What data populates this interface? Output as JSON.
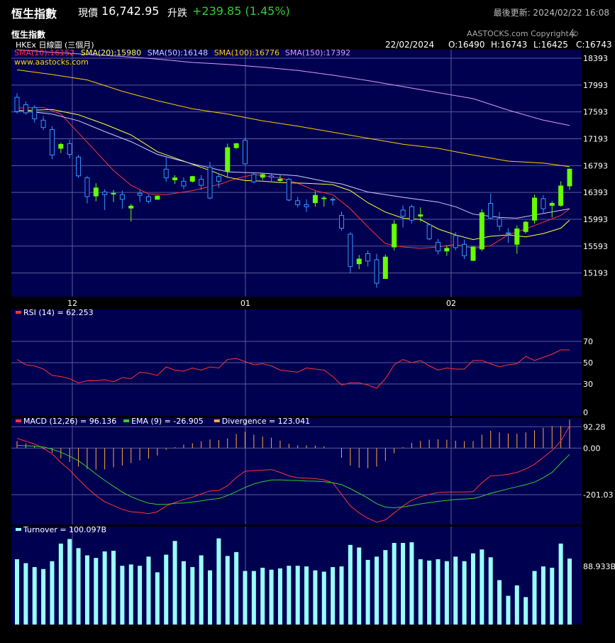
{
  "header": {
    "title": "恆生指數",
    "price_label": "現價",
    "price": "16,742.95",
    "change_label": "升跌",
    "change": "+239.85 (1.45%)",
    "updated": "最後更新: 2024/02/22 16:08"
  },
  "chart_header": {
    "index_name": "恆生指數",
    "source": "HKEx 日線圖 (三個月)",
    "copyright": "AASTOCKS.com Copyright ©",
    "website": "www.aastocks.com",
    "date": "22/02/2024",
    "open": "O:16490",
    "high": "H:16743",
    "low": "L:16425",
    "close": "C:16743"
  },
  "colors": {
    "panel_bg": "#000050",
    "up_candle": "#66ff00",
    "down_candle": "#3399ff",
    "sma10": "#ff3333",
    "sma20": "#ffff33",
    "sma50": "#ccccff",
    "sma100": "#ffcc00",
    "sma150": "#dd99ff",
    "rsi": "#ff3333",
    "macd": "#ff3333",
    "ema": "#33cc33",
    "divergence": "#ffaa33",
    "turnover": "#99ffff"
  },
  "chart_data": [
    {
      "type": "candlestick",
      "title": "恆生指數",
      "legend": [
        {
          "name": "SMA(10)",
          "value": "16152"
        },
        {
          "name": "SMA(20)",
          "value": "15980"
        },
        {
          "name": "SMA(50)",
          "value": "16148"
        },
        {
          "name": "SMA(100)",
          "value": "16776"
        },
        {
          "name": "SMA(150)",
          "value": "17392"
        }
      ],
      "x_ticks": [
        "12",
        "01",
        "02"
      ],
      "y_ticks": [
        18393,
        17993,
        17593,
        17193,
        16793,
        16393,
        15993,
        15593,
        15193
      ],
      "ylim": [
        14840,
        18520
      ],
      "candles": [
        [
          17810,
          17870,
          17570,
          17600
        ],
        [
          17700,
          17750,
          17550,
          17580
        ],
        [
          17660,
          17690,
          17430,
          17490
        ],
        [
          17470,
          17530,
          17320,
          17360
        ],
        [
          17330,
          17380,
          16890,
          16950
        ],
        [
          17050,
          17130,
          16980,
          17110
        ],
        [
          17120,
          17180,
          16900,
          16960
        ],
        [
          16920,
          16950,
          16610,
          16640
        ],
        [
          16610,
          16640,
          16230,
          16330
        ],
        [
          16340,
          16530,
          16260,
          16460
        ],
        [
          16400,
          16440,
          16130,
          16360
        ],
        [
          16380,
          16430,
          16250,
          16380
        ],
        [
          16360,
          16420,
          16150,
          16290
        ],
        [
          16160,
          16220,
          15960,
          16190
        ],
        [
          16380,
          16430,
          16250,
          16350
        ],
        [
          16330,
          16360,
          16230,
          16260
        ],
        [
          16290,
          16340,
          16290,
          16340
        ],
        [
          16740,
          16930,
          16550,
          16610
        ],
        [
          16580,
          16650,
          16520,
          16610
        ],
        [
          16560,
          16620,
          16440,
          16490
        ],
        [
          16560,
          16640,
          16540,
          16630
        ],
        [
          16590,
          16650,
          16430,
          16500
        ],
        [
          16770,
          16850,
          16290,
          16310
        ],
        [
          16630,
          16660,
          16460,
          16560
        ],
        [
          16710,
          17120,
          16620,
          17060
        ],
        [
          17060,
          17130,
          17040,
          17120
        ],
        [
          17170,
          17210,
          16810,
          16820
        ],
        [
          16660,
          16680,
          16530,
          16550
        ],
        [
          16620,
          16680,
          16580,
          16660
        ],
        [
          16640,
          16680,
          16560,
          16620
        ],
        [
          16570,
          16650,
          16540,
          16590
        ],
        [
          16590,
          16610,
          16260,
          16280
        ],
        [
          16270,
          16330,
          16170,
          16210
        ],
        [
          16210,
          16290,
          16100,
          16180
        ],
        [
          16240,
          16410,
          16180,
          16350
        ],
        [
          16310,
          16340,
          16180,
          16310
        ],
        [
          16290,
          16320,
          16200,
          16280
        ],
        [
          16050,
          16110,
          15820,
          15860
        ],
        [
          15770,
          15800,
          15190,
          15290
        ],
        [
          15330,
          15460,
          15250,
          15400
        ],
        [
          15480,
          15530,
          15290,
          15370
        ],
        [
          15390,
          15480,
          14970,
          15040
        ],
        [
          15110,
          15470,
          15110,
          15430
        ],
        [
          15580,
          15980,
          15530,
          15920
        ],
        [
          16130,
          16200,
          15870,
          16040
        ],
        [
          16180,
          16210,
          15930,
          15980
        ],
        [
          16040,
          16170,
          15960,
          16060
        ],
        [
          15910,
          15930,
          15680,
          15700
        ],
        [
          15650,
          15700,
          15470,
          15520
        ],
        [
          15520,
          15600,
          15450,
          15560
        ],
        [
          15750,
          15800,
          15530,
          15570
        ],
        [
          15620,
          15690,
          15400,
          15450
        ],
        [
          15380,
          15590,
          15370,
          15580
        ],
        [
          15550,
          16140,
          15520,
          16090
        ],
        [
          16230,
          16380,
          16000,
          16010
        ],
        [
          16000,
          16100,
          15820,
          15890
        ],
        [
          15790,
          15860,
          15640,
          15780
        ],
        [
          15620,
          15900,
          15480,
          15850
        ],
        [
          15810,
          15970,
          15780,
          15950
        ],
        [
          15980,
          16360,
          15930,
          16310
        ],
        [
          16300,
          16350,
          16090,
          16150
        ],
        [
          16200,
          16260,
          16020,
          16230
        ],
        [
          16200,
          16560,
          16180,
          16490
        ],
        [
          16490,
          16750,
          16430,
          16740
        ]
      ],
      "sma": {
        "SMA(10)": [
          [
            0,
            17650
          ],
          [
            3,
            17660
          ],
          [
            5,
            17560
          ],
          [
            7,
            17280
          ],
          [
            9,
            17000
          ],
          [
            11,
            16720
          ],
          [
            13,
            16500
          ],
          [
            15,
            16370
          ],
          [
            17,
            16360
          ],
          [
            20,
            16420
          ],
          [
            23,
            16510
          ],
          [
            25,
            16600
          ],
          [
            27,
            16660
          ],
          [
            30,
            16610
          ],
          [
            32,
            16530
          ],
          [
            34,
            16420
          ],
          [
            36,
            16360
          ],
          [
            38,
            16150
          ],
          [
            40,
            15880
          ],
          [
            42,
            15630
          ],
          [
            44,
            15580
          ],
          [
            46,
            15560
          ],
          [
            48,
            15580
          ],
          [
            50,
            15620
          ],
          [
            52,
            15560
          ],
          [
            54,
            15600
          ],
          [
            56,
            15760
          ],
          [
            58,
            15850
          ],
          [
            60,
            15950
          ],
          [
            62,
            16050
          ],
          [
            63,
            16150
          ]
        ],
        "SMA(20)": [
          [
            0,
            17610
          ],
          [
            4,
            17630
          ],
          [
            7,
            17550
          ],
          [
            10,
            17410
          ],
          [
            13,
            17250
          ],
          [
            16,
            17000
          ],
          [
            19,
            16860
          ],
          [
            22,
            16720
          ],
          [
            24,
            16620
          ],
          [
            26,
            16570
          ],
          [
            28,
            16560
          ],
          [
            30,
            16540
          ],
          [
            33,
            16530
          ],
          [
            36,
            16510
          ],
          [
            38,
            16420
          ],
          [
            40,
            16240
          ],
          [
            42,
            16100
          ],
          [
            44,
            16010
          ],
          [
            46,
            15990
          ],
          [
            48,
            15850
          ],
          [
            50,
            15760
          ],
          [
            52,
            15690
          ],
          [
            54,
            15740
          ],
          [
            56,
            15760
          ],
          [
            58,
            15730
          ],
          [
            60,
            15780
          ],
          [
            62,
            15860
          ],
          [
            63,
            15980
          ]
        ],
        "SMA(50)": [
          [
            0,
            17620
          ],
          [
            4,
            17560
          ],
          [
            7,
            17460
          ],
          [
            10,
            17300
          ],
          [
            13,
            17150
          ],
          [
            16,
            16960
          ],
          [
            20,
            16820
          ],
          [
            24,
            16700
          ],
          [
            28,
            16680
          ],
          [
            32,
            16640
          ],
          [
            35,
            16560
          ],
          [
            37,
            16520
          ],
          [
            40,
            16400
          ],
          [
            44,
            16320
          ],
          [
            48,
            16250
          ],
          [
            50,
            16180
          ],
          [
            52,
            16070
          ],
          [
            55,
            16020
          ],
          [
            57,
            16010
          ],
          [
            60,
            16080
          ],
          [
            63,
            16150
          ]
        ],
        "SMA(100)": [
          [
            0,
            18220
          ],
          [
            4,
            18150
          ],
          [
            8,
            18070
          ],
          [
            12,
            17900
          ],
          [
            16,
            17760
          ],
          [
            20,
            17640
          ],
          [
            24,
            17560
          ],
          [
            28,
            17460
          ],
          [
            32,
            17380
          ],
          [
            36,
            17290
          ],
          [
            40,
            17200
          ],
          [
            44,
            17110
          ],
          [
            48,
            17050
          ],
          [
            52,
            16950
          ],
          [
            56,
            16860
          ],
          [
            60,
            16830
          ],
          [
            63,
            16776
          ]
        ],
        "SMA(150)": [
          [
            0,
            18520
          ],
          [
            4,
            18480
          ],
          [
            8,
            18450
          ],
          [
            12,
            18420
          ],
          [
            16,
            18380
          ],
          [
            20,
            18330
          ],
          [
            24,
            18300
          ],
          [
            28,
            18260
          ],
          [
            32,
            18210
          ],
          [
            36,
            18140
          ],
          [
            40,
            18060
          ],
          [
            44,
            17970
          ],
          [
            48,
            17880
          ],
          [
            52,
            17790
          ],
          [
            56,
            17620
          ],
          [
            60,
            17470
          ],
          [
            63,
            17392
          ]
        ]
      }
    },
    {
      "type": "line",
      "title": "RSI (14)",
      "legend_label": "RSI (14) = 62.253",
      "y_ticks": [
        70,
        50,
        30,
        0
      ],
      "ylim": [
        0,
        100
      ],
      "values": [
        53,
        48,
        47,
        44,
        38,
        37,
        35,
        31,
        33,
        33,
        34,
        32,
        36,
        35,
        41,
        40,
        38,
        46,
        43,
        42,
        45,
        43,
        46,
        45,
        53,
        54,
        51,
        48,
        49,
        47,
        43,
        42,
        41,
        45,
        44,
        43,
        37,
        29,
        31,
        31,
        29,
        26,
        35,
        48,
        53,
        50,
        52,
        47,
        43,
        45,
        44,
        44,
        52,
        52,
        49,
        46,
        48,
        49,
        56,
        52,
        55,
        58,
        62,
        62
      ]
    },
    {
      "type": "line",
      "title": "MACD",
      "legend": [
        {
          "name": "MACD (12,26)",
          "value": "96.136"
        },
        {
          "name": "EMA (9)",
          "value": "-26.905"
        },
        {
          "name": "Divergence",
          "value": "123.041"
        }
      ],
      "y_ticks": [
        92.28,
        0.0,
        -201.03
      ],
      "ylim": [
        -330,
        130
      ],
      "macd": [
        42,
        30,
        18,
        0,
        -25,
        -62,
        -95,
        -135,
        -172,
        -205,
        -232,
        -248,
        -265,
        -275,
        -278,
        -283,
        -275,
        -250,
        -235,
        -222,
        -212,
        -198,
        -185,
        -183,
        -163,
        -127,
        -100,
        -97,
        -95,
        -93,
        -105,
        -120,
        -128,
        -130,
        -132,
        -137,
        -150,
        -200,
        -250,
        -280,
        -303,
        -320,
        -310,
        -280,
        -250,
        -225,
        -210,
        -200,
        -192,
        -190,
        -190,
        -190,
        -188,
        -150,
        -120,
        -118,
        -113,
        -105,
        -90,
        -70,
        -40,
        -10,
        30,
        96
      ],
      "ema": [
        12,
        10,
        8,
        5,
        -5,
        -18,
        -35,
        -55,
        -82,
        -112,
        -140,
        -165,
        -190,
        -210,
        -225,
        -238,
        -243,
        -243,
        -239,
        -237,
        -233,
        -228,
        -222,
        -218,
        -205,
        -188,
        -170,
        -155,
        -145,
        -138,
        -137,
        -139,
        -140,
        -142,
        -143,
        -145,
        -150,
        -158,
        -175,
        -195,
        -216,
        -240,
        -255,
        -258,
        -254,
        -248,
        -241,
        -236,
        -230,
        -226,
        -222,
        -220,
        -218,
        -208,
        -195,
        -186,
        -176,
        -167,
        -158,
        -147,
        -128,
        -105,
        -65,
        -27
      ],
      "divergence": [
        30,
        20,
        10,
        -5,
        -20,
        -44,
        -60,
        -80,
        -90,
        -93,
        -92,
        -83,
        -75,
        -65,
        -53,
        -45,
        -32,
        -7,
        4,
        15,
        21,
        30,
        37,
        35,
        42,
        61,
        70,
        58,
        50,
        45,
        32,
        19,
        12,
        12,
        11,
        8,
        0,
        -42,
        -75,
        -85,
        -87,
        -80,
        -55,
        -22,
        4,
        23,
        31,
        36,
        38,
        36,
        32,
        30,
        30,
        58,
        75,
        68,
        63,
        62,
        68,
        77,
        88,
        95,
        95,
        123
      ]
    },
    {
      "type": "bar",
      "title": "Turnover",
      "legend_label": "Turnover = 100.097B",
      "y_ticks": [
        "88.933B"
      ],
      "values": [
        100,
        94,
        88,
        85,
        97,
        124,
        131,
        117,
        106,
        102,
        112,
        113,
        90,
        92,
        90,
        104,
        80,
        107,
        128,
        97,
        88,
        106,
        83,
        132,
        105,
        111,
        82,
        82,
        87,
        84,
        86,
        90,
        90,
        89,
        83,
        81,
        88,
        89,
        122,
        118,
        99,
        104,
        114,
        125,
        125,
        126,
        100,
        98,
        100,
        97,
        104,
        97,
        109,
        115,
        103,
        68,
        44,
        60,
        42,
        82,
        89,
        87,
        124,
        101
      ]
    }
  ]
}
